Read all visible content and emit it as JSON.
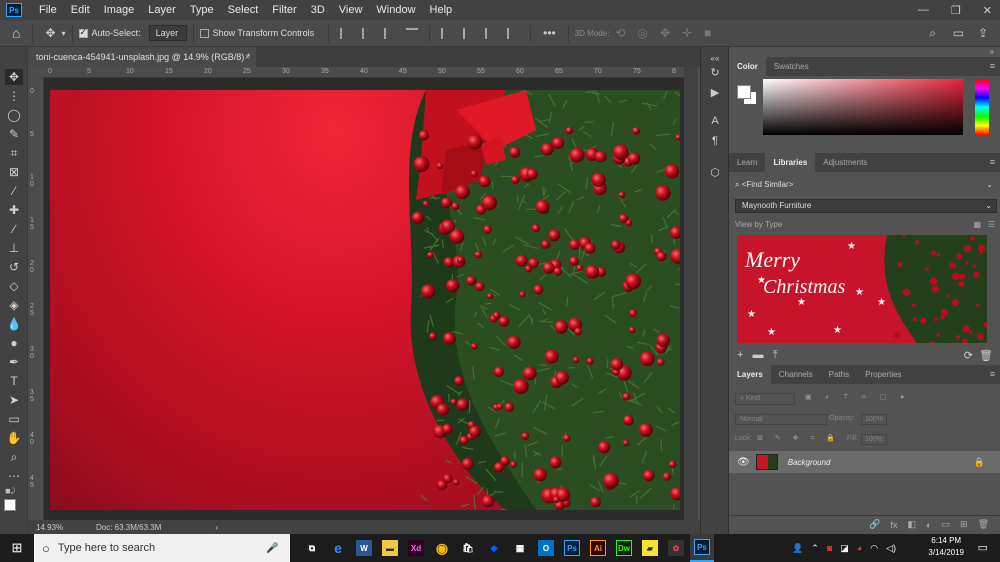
{
  "menubar": {
    "logo": "Ps",
    "items": [
      "File",
      "Edit",
      "Image",
      "Layer",
      "Type",
      "Select",
      "Filter",
      "3D",
      "View",
      "Window",
      "Help"
    ],
    "window_controls": [
      "—",
      "❐",
      "✕"
    ]
  },
  "options": {
    "auto_select_label": "Auto-Select:",
    "auto_select_checked": true,
    "layer_dropdown": "Layer",
    "show_transform_label": "Show Transform Controls",
    "show_transform_checked": false,
    "mode_3d_label": "3D Mode:",
    "more": "•••"
  },
  "document": {
    "tab_title": "toni-cuenca-454941-unsplash.jpg @ 14.9% (RGB/8) *",
    "close": "×",
    "zoom": "14.93%",
    "doc_info": "Doc: 63.3M/63.3M"
  },
  "rulers": {
    "h_ticks": [
      "0",
      "5",
      "10",
      "15",
      "20",
      "25",
      "30",
      "35",
      "40",
      "45",
      "50",
      "55",
      "60",
      "65",
      "70",
      "75",
      "8"
    ],
    "v_ticks": [
      "0",
      "5",
      "1 0",
      "1 5",
      "2 0",
      "2 5",
      "3 0",
      "3 5",
      "4 0",
      "4 5"
    ]
  },
  "panels": {
    "color_tabs": [
      "Color",
      "Swatches"
    ],
    "library_tabs": [
      "Learn",
      "Libraries",
      "Adjustments"
    ],
    "find_similar": "<Find Similar>",
    "library_name": "Maynooth Furniture",
    "view_by": "View by Type",
    "thumb_text_line1": "Merry",
    "thumb_text_line2": "Christmas",
    "layers_tabs": [
      "Layers",
      "Channels",
      "Paths",
      "Properties"
    ],
    "kind_label": "Kind",
    "blend_mode": "Normal",
    "opacity_label": "Opacity:",
    "opacity_value": "100%",
    "lock_label": "Lock:",
    "fill_label": "Fill:",
    "fill_value": "100%",
    "layer_name": "Background",
    "footer_icons": [
      "🔗",
      "fx",
      "◧",
      "◐",
      "▭",
      "⊞",
      "🗑"
    ]
  },
  "taskbar": {
    "search_placeholder": "Type here to search",
    "apps": [
      "Xd",
      "Ps",
      "Ai",
      "Dw",
      "Ps"
    ],
    "time": "6:14 PM",
    "date": "3/14/2019"
  },
  "colors": {
    "accent": "#31a8ff",
    "canvas_red": "#d4132a"
  }
}
